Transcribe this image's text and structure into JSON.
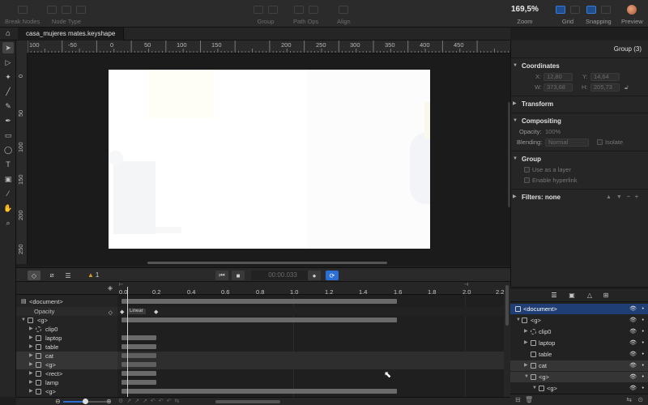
{
  "toolbar": {
    "break_nodes": "Break Nodes",
    "node_type": "Node Type",
    "group": "Group",
    "path_ops": "Path Ops",
    "align": "Align",
    "zoom_value": "169,5%",
    "zoom_label": "Zoom",
    "grid": "Grid",
    "snapping": "Snapping",
    "preview": "Preview"
  },
  "tab": {
    "filename": "casa_mujeres mates.keyshape"
  },
  "ruler_h": [
    "100",
    "-50",
    "0",
    "50",
    "100",
    "150",
    "200",
    "250",
    "300",
    "350",
    "400",
    "450"
  ],
  "ruler_v": [
    "0",
    "50",
    "100",
    "150",
    "200",
    "250"
  ],
  "timeline": {
    "warning_count": "1",
    "time": "00:00.033",
    "ticks": [
      "0.0",
      "0.2",
      "0.4",
      "0.6",
      "0.8",
      "1.0",
      "1.2",
      "1.4",
      "1.6",
      "1.8",
      "2.0",
      "2.2"
    ],
    "linear_label": "Linear",
    "rows": [
      {
        "label": "<document>"
      },
      {
        "label": "Opacity"
      },
      {
        "label": "<g>"
      },
      {
        "label": "clip0"
      },
      {
        "label": "laptop"
      },
      {
        "label": "table"
      },
      {
        "label": "cat"
      },
      {
        "label": "<g>"
      },
      {
        "label": "<rect>"
      },
      {
        "label": "lamp"
      },
      {
        "label": "<g>"
      }
    ]
  },
  "inspector": {
    "title": "Group (3)",
    "coordinates": "Coordinates",
    "x_label": "X:",
    "x_value": "12,80",
    "y_label": "Y:",
    "y_value": "14,64",
    "w_label": "W:",
    "w_value": "373,68",
    "h_label": "H:",
    "h_value": "205,73",
    "transform": "Transform",
    "compositing": "Compositing",
    "opacity_label": "Opacity:",
    "opacity_value": "100%",
    "blending_label": "Blending:",
    "blending_value": "Normal",
    "isolate": "Isolate",
    "group": "Group",
    "use_as_layer": "Use as a layer",
    "enable_hyperlink": "Enable hyperlink",
    "filters": "Filters: none"
  },
  "layers": {
    "rows": [
      {
        "label": "<document>"
      },
      {
        "label": "<g>"
      },
      {
        "label": "clip0"
      },
      {
        "label": "laptop"
      },
      {
        "label": "table"
      },
      {
        "label": "cat"
      },
      {
        "label": "<g>"
      },
      {
        "label": "<g>"
      }
    ]
  },
  "colors": {
    "accent": "#2b6fd6",
    "selection": "#1f3f74",
    "warning": "#d99b2a"
  }
}
